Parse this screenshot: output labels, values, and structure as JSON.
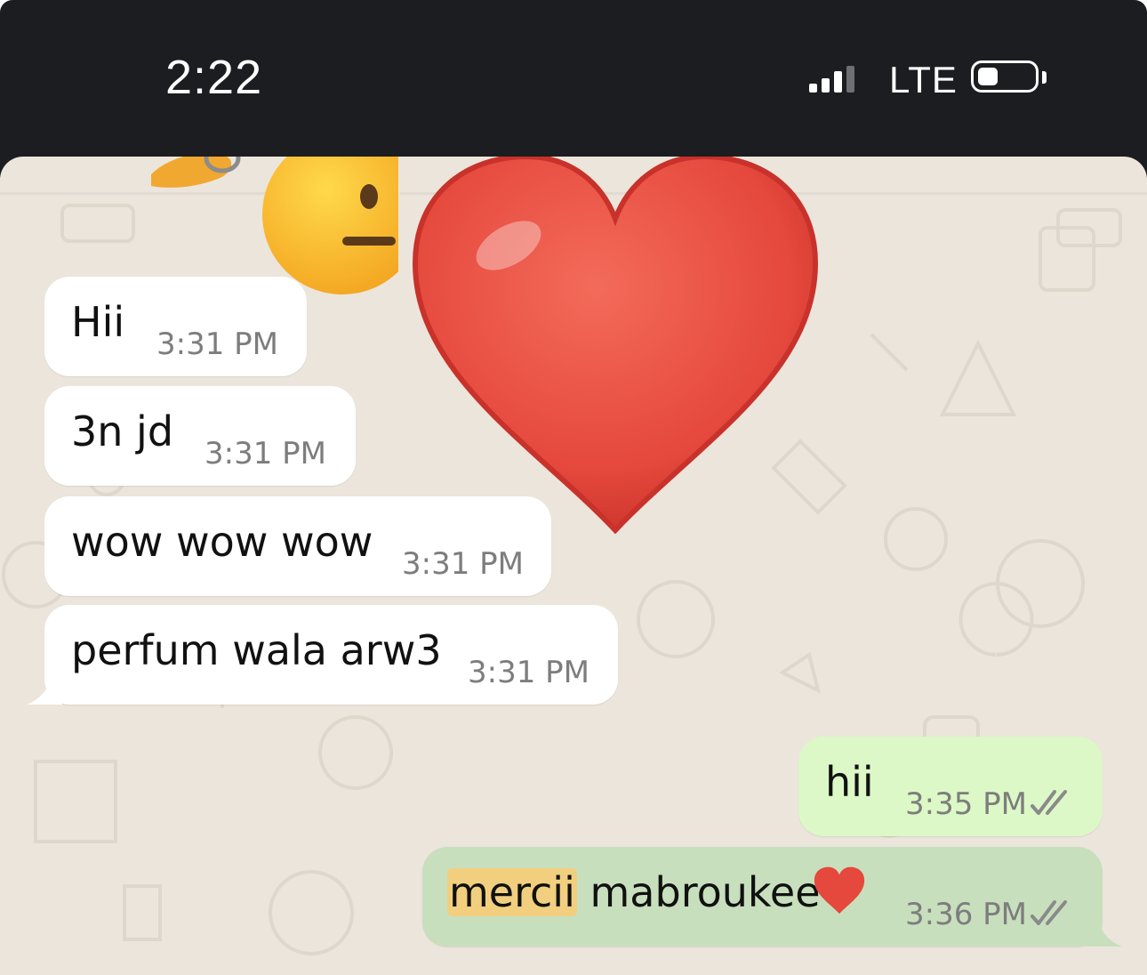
{
  "status_bar": {
    "time": "2:22",
    "network": "LTE",
    "signal_bars_filled": 3,
    "signal_bars_total": 4
  },
  "colors": {
    "status_bg": "#1b1d20",
    "chat_bg": "#ece5dc",
    "incoming_bubble": "#ffffff",
    "outgoing_bubble": "#dcf8c6",
    "highlight": "#f2cf7f",
    "heart": "#e5483c"
  },
  "overlay": {
    "emoji_left": "face-with-hand-emoji",
    "emoji_big": "red-heart-emoji"
  },
  "messages": [
    {
      "direction": "in",
      "text": "Hii",
      "time": "3:31 PM"
    },
    {
      "direction": "in",
      "text": "3n jd",
      "time": "3:31 PM"
    },
    {
      "direction": "in",
      "text": "wow wow wow",
      "time": "3:31 PM"
    },
    {
      "direction": "in",
      "text": "perfum wala arw3",
      "time": "3:31 PM"
    },
    {
      "direction": "out",
      "text": "hii",
      "time": "3:35 PM",
      "status": "double-check-icon"
    },
    {
      "direction": "out",
      "text_highlight": "mercii",
      "text_rest": " mabroukee",
      "emoji": "❤️",
      "time": "3:36 PM",
      "status": "double-check-icon"
    }
  ]
}
